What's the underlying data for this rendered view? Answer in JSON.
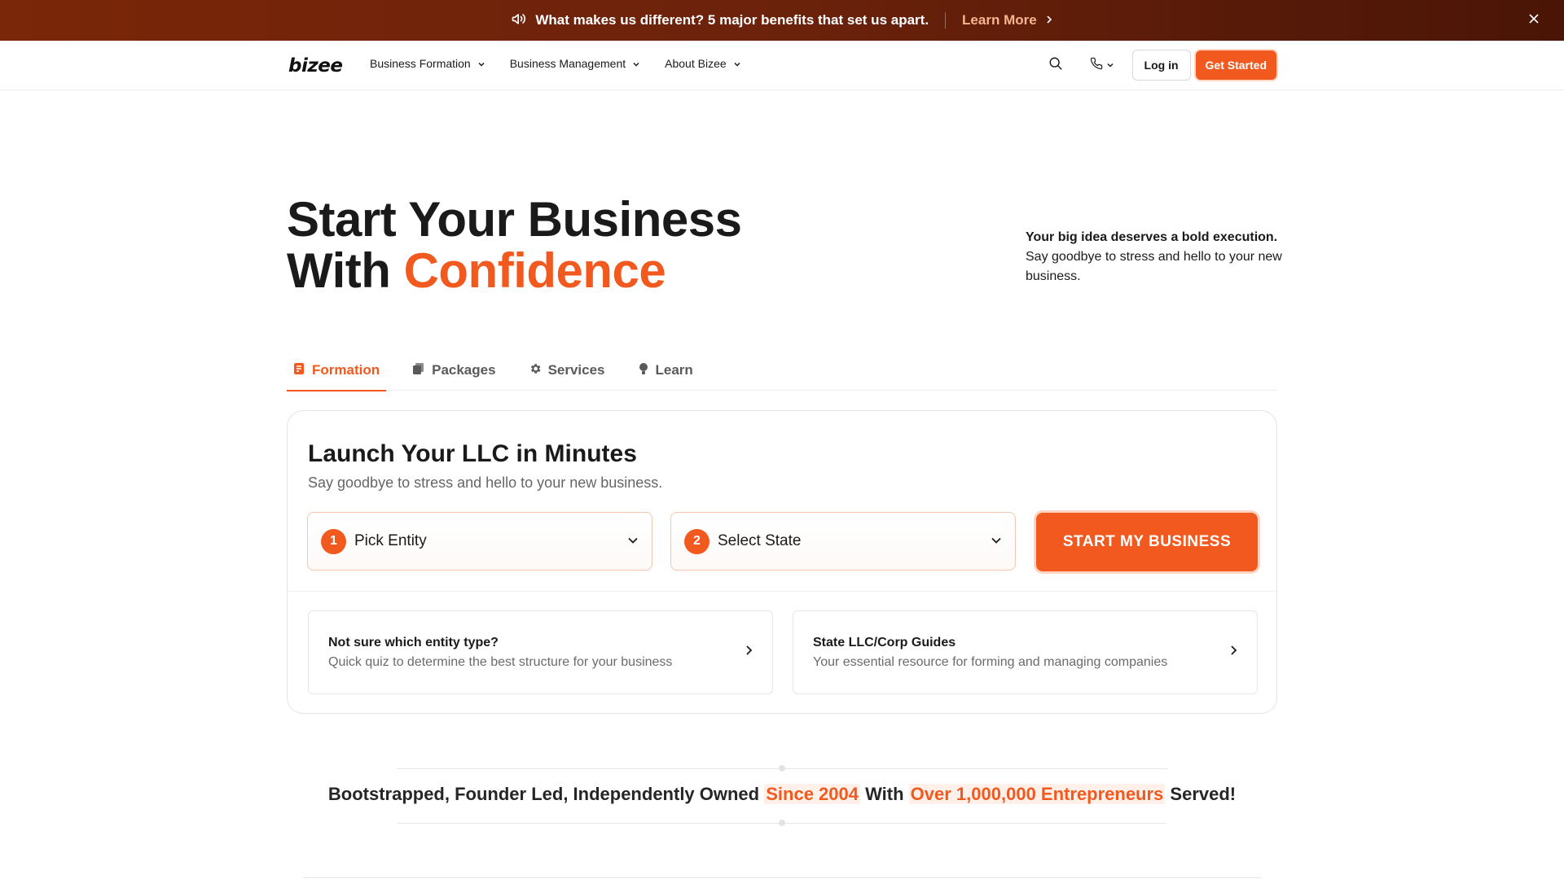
{
  "announcement": {
    "message": "What makes us different? 5 major benefits that set us apart.",
    "link_label": "Learn More",
    "icons": [
      "megaphone-icon",
      "chevron-right-icon",
      "close-icon"
    ]
  },
  "nav": {
    "logo": "bizee",
    "menu": [
      {
        "label": "Business Formation"
      },
      {
        "label": "Business Management"
      },
      {
        "label": "About Bizee"
      }
    ],
    "login_label": "Log in",
    "cta_label": "Get Started",
    "icons": [
      "search-icon",
      "phone-icon",
      "chevron-down-icon"
    ]
  },
  "hero": {
    "title_line1": "Start Your Business",
    "title_line2_prefix": "With ",
    "title_line2_accent": "Confidence",
    "side_bold": "Your big idea deserves a bold execution.",
    "side_text": "Say goodbye to stress and hello to your new business."
  },
  "tabs": [
    {
      "label": "Formation",
      "icon": "document-icon",
      "active": true
    },
    {
      "label": "Packages",
      "icon": "stack-icon",
      "active": false
    },
    {
      "label": "Services",
      "icon": "gear-icon",
      "active": false
    },
    {
      "label": "Learn",
      "icon": "lightbulb-icon",
      "active": false
    }
  ],
  "formation_card": {
    "title": "Launch Your LLC in Minutes",
    "subtitle": "Say goodbye to stress and hello to your new business.",
    "entity_select": {
      "step": "1",
      "label": "Pick Entity"
    },
    "state_select": {
      "step": "2",
      "label": "Select State"
    },
    "start_button": "START MY BUSINESS",
    "guides": [
      {
        "title": "Not sure which entity type?",
        "description": "Quick quiz to determine the best structure for your business"
      },
      {
        "title": "State LLC/Corp Guides",
        "description": "Your essential resource for forming and managing companies"
      }
    ]
  },
  "trust": {
    "part1": "Bootstrapped, Founder Led, Independently Owned ",
    "highlight1": "Since 2004",
    "part2": " With ",
    "highlight2": "Over 1,000,000 Entrepreneurs",
    "part3": " Served!"
  },
  "colors": {
    "accent": "#f2591f",
    "announcement_bg": "#6b220b",
    "text": "#1a1a1a"
  }
}
